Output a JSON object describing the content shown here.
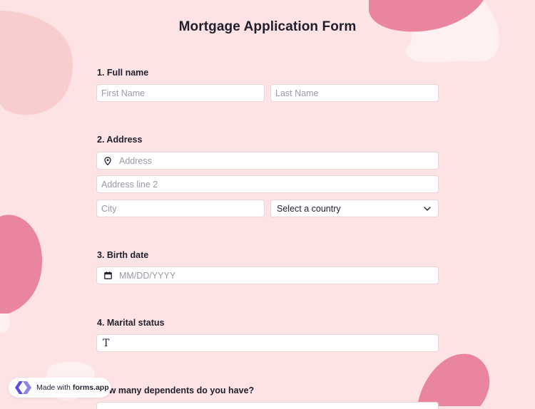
{
  "form": {
    "title": "Mortgage Application Form",
    "questions": [
      {
        "label": "1.  Full name"
      },
      {
        "label": "2. Address"
      },
      {
        "label": "3. Birth date"
      },
      {
        "label": "4. Marital status"
      },
      {
        "label": "How many dependents do you have?"
      }
    ],
    "full_name": {
      "first_placeholder": "First Name",
      "last_placeholder": "Last Name"
    },
    "address": {
      "line1_placeholder": "Address",
      "line2_placeholder": "Address line 2",
      "city_placeholder": "City",
      "country_selected": "Select a country"
    },
    "birth_date": {
      "placeholder": "MM/DD/YYYY"
    },
    "marital_status": {
      "text_icon": "T"
    }
  },
  "badge": {
    "prefix": "Made with",
    "brand": "forms.app"
  },
  "icons": {
    "location": "location-pin-icon",
    "calendar": "calendar-icon",
    "chevron": "chevron-down-icon",
    "text": "text-type-icon",
    "logo": "forms-app-logo-icon"
  },
  "colors": {
    "background": "#fde3e3",
    "blob_dark": "#e9859c",
    "blob_light": "#f7cdcd",
    "blob_white": "#fff1f1",
    "field_border": "#e8d6d6",
    "placeholder": "#9a9aa5",
    "text": "#1f1f2e",
    "logo": "#5b4de0"
  }
}
